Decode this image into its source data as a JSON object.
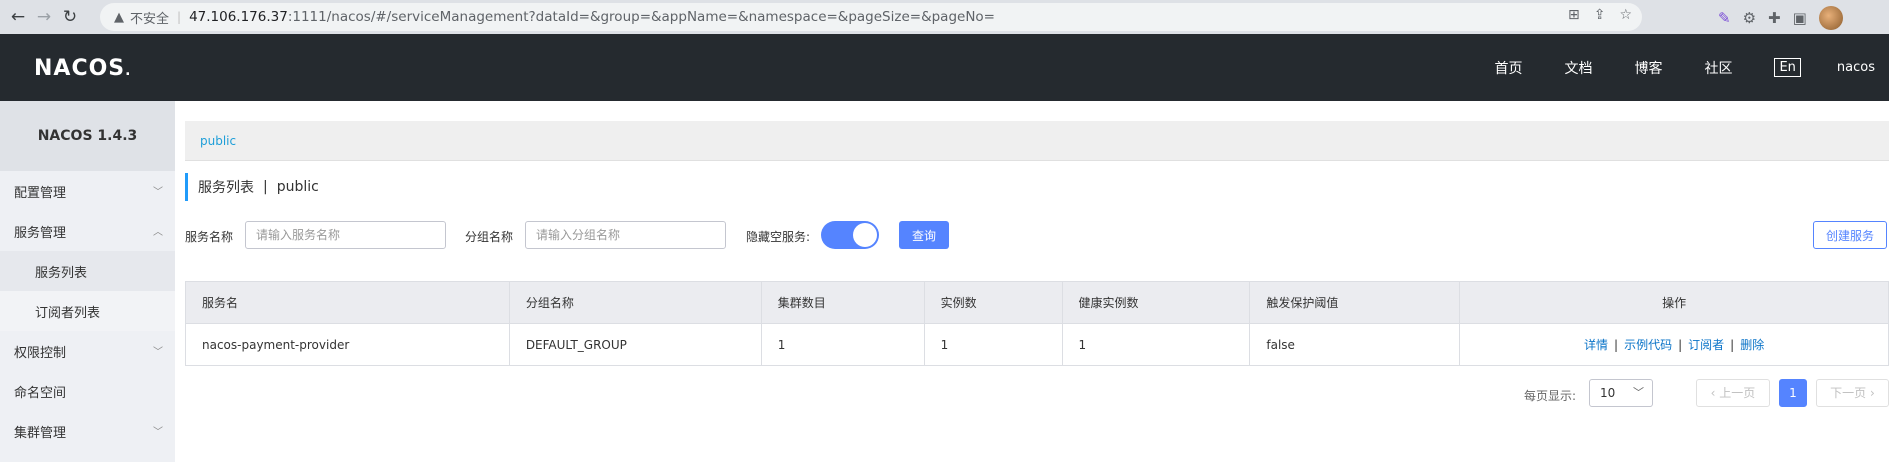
{
  "browser": {
    "insecure_label": "不安全",
    "url_host": "47.106.176.37",
    "url_rest": ":1111/nacos/#/serviceManagement?dataId=&group=&appName=&namespace=&pageSize=&pageNo="
  },
  "header": {
    "logo": "NACOS",
    "nav": [
      "首页",
      "文档",
      "博客",
      "社区"
    ],
    "lang": "En",
    "user": "nacos"
  },
  "sidebar": {
    "version": "NACOS 1.4.3",
    "items": [
      {
        "label": "配置管理",
        "chevron": "down"
      },
      {
        "label": "服务管理",
        "chevron": "up"
      },
      {
        "label": "服务列表",
        "sub": true
      },
      {
        "label": "订阅者列表",
        "sub": true
      },
      {
        "label": "权限控制",
        "chevron": "down"
      },
      {
        "label": "命名空间"
      },
      {
        "label": "集群管理",
        "chevron": "down"
      }
    ]
  },
  "breadcrumb": "public",
  "page": {
    "title": "服务列表",
    "namespace": "public"
  },
  "filters": {
    "service_label": "服务名称",
    "service_placeholder": "请输入服务名称",
    "group_label": "分组名称",
    "group_placeholder": "请输入分组名称",
    "hide_empty_label": "隐藏空服务:",
    "hide_empty_on": true,
    "query_button": "查询",
    "create_button": "创建服务"
  },
  "table": {
    "columns": [
      "服务名",
      "分组名称",
      "集群数目",
      "实例数",
      "健康实例数",
      "触发保护阈值",
      "操作"
    ],
    "rows": [
      {
        "service": "nacos-payment-provider",
        "group": "DEFAULT_GROUP",
        "clusters": "1",
        "instances": "1",
        "healthy": "1",
        "threshold": "false",
        "ops": [
          "详情",
          "示例代码",
          "订阅者",
          "删除"
        ]
      }
    ]
  },
  "pagination": {
    "page_size_label": "每页显示:",
    "page_size": "10",
    "prev": "上一页",
    "current_page": "1",
    "next": "下一页"
  },
  "colors": {
    "accent": "#5584ff",
    "header_bg": "#252a2f",
    "link": "#0b74c8"
  }
}
